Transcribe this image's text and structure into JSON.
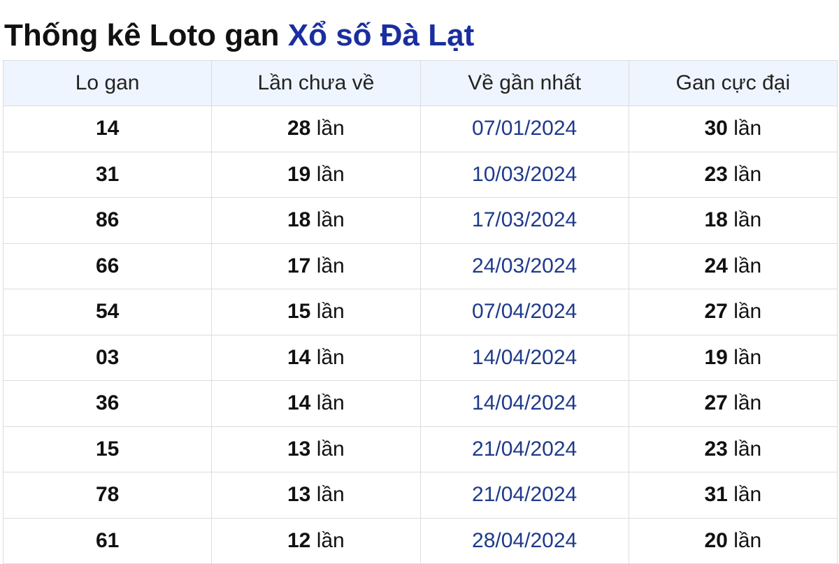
{
  "title": {
    "prefix": "Thống kê Loto gan",
    "link": "Xổ số Đà Lạt",
    "link_color": "#1a2ea0"
  },
  "table": {
    "headers": [
      "Lo gan",
      "Lần chưa về",
      "Về gần nhất",
      "Gan cực đại"
    ],
    "header_bg": "#eef5ff",
    "date_color": "#1f3a8a",
    "rows": [
      {
        "lo": "14",
        "missed": "28",
        "missed_unit": "lần",
        "last_seen": "07/01/2024",
        "max_gap": "30",
        "max_unit": "lần"
      },
      {
        "lo": "31",
        "missed": "19",
        "missed_unit": "lần",
        "last_seen": "10/03/2024",
        "max_gap": "23",
        "max_unit": "lần"
      },
      {
        "lo": "86",
        "missed": "18",
        "missed_unit": "lần",
        "last_seen": "17/03/2024",
        "max_gap": "18",
        "max_unit": "lần"
      },
      {
        "lo": "66",
        "missed": "17",
        "missed_unit": "lần",
        "last_seen": "24/03/2024",
        "max_gap": "24",
        "max_unit": "lần"
      },
      {
        "lo": "54",
        "missed": "15",
        "missed_unit": "lần",
        "last_seen": "07/04/2024",
        "max_gap": "27",
        "max_unit": "lần"
      },
      {
        "lo": "03",
        "missed": "14",
        "missed_unit": "lần",
        "last_seen": "14/04/2024",
        "max_gap": "19",
        "max_unit": "lần"
      },
      {
        "lo": "36",
        "missed": "14",
        "missed_unit": "lần",
        "last_seen": "14/04/2024",
        "max_gap": "27",
        "max_unit": "lần"
      },
      {
        "lo": "15",
        "missed": "13",
        "missed_unit": "lần",
        "last_seen": "21/04/2024",
        "max_gap": "23",
        "max_unit": "lần"
      },
      {
        "lo": "78",
        "missed": "13",
        "missed_unit": "lần",
        "last_seen": "21/04/2024",
        "max_gap": "31",
        "max_unit": "lần"
      },
      {
        "lo": "61",
        "missed": "12",
        "missed_unit": "lần",
        "last_seen": "28/04/2024",
        "max_gap": "20",
        "max_unit": "lần"
      }
    ]
  }
}
